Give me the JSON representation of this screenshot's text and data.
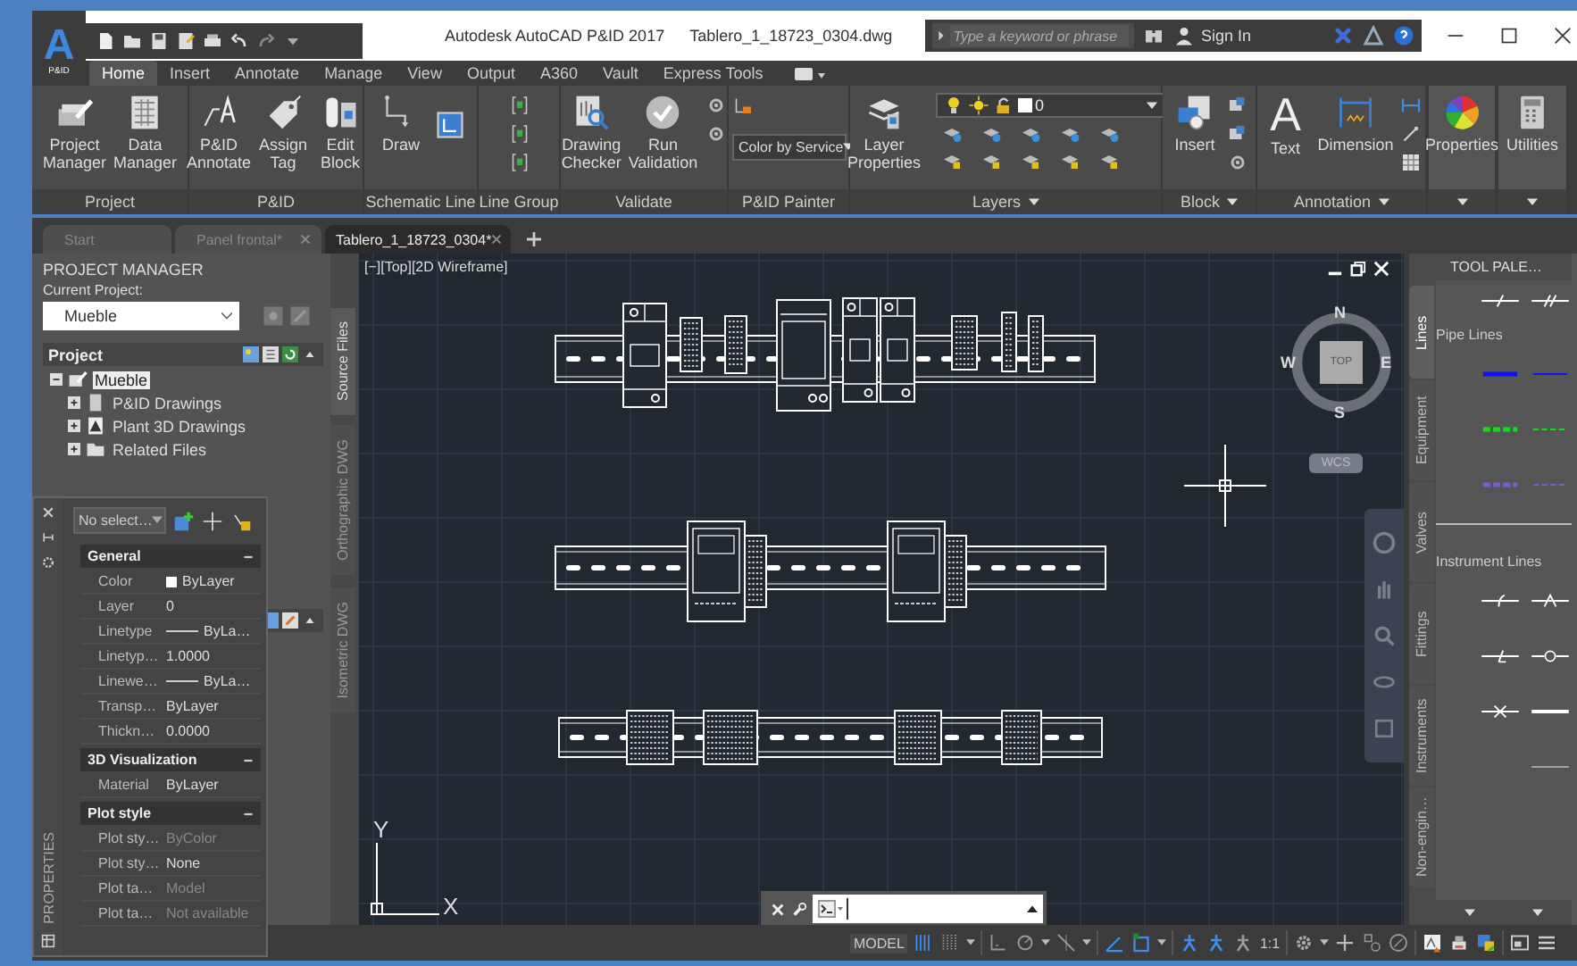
{
  "app": {
    "logo": "A",
    "logo_sub": "P&ID"
  },
  "title": {
    "app_name": "Autodesk AutoCAD P&ID 2017",
    "file": "Tablero_1_18723_0304.dwg"
  },
  "search": {
    "placeholder": "Type a keyword or phrase"
  },
  "sign_in": "Sign In",
  "ribbon_tabs": [
    {
      "label": "Home",
      "selected": true
    },
    {
      "label": "Insert",
      "selected": false
    },
    {
      "label": "Annotate",
      "selected": false
    },
    {
      "label": "Manage",
      "selected": false
    },
    {
      "label": "View",
      "selected": false
    },
    {
      "label": "Output",
      "selected": false
    },
    {
      "label": "A360",
      "selected": false
    },
    {
      "label": "Vault",
      "selected": false
    },
    {
      "label": "Express Tools",
      "selected": false
    }
  ],
  "ribbon_panels": [
    {
      "title": "Project",
      "buttons": [
        {
          "label": "Project Manager"
        },
        {
          "label": "Data Manager"
        }
      ]
    },
    {
      "title": "P&ID",
      "buttons": [
        {
          "label": "P&ID Annotate"
        },
        {
          "label": "Assign Tag"
        },
        {
          "label": "Edit Block"
        }
      ]
    },
    {
      "title": "Schematic Line",
      "buttons": [
        {
          "label": "Draw"
        }
      ]
    },
    {
      "title": "Line Group"
    },
    {
      "title": "Validate",
      "buttons": [
        {
          "label": "Drawing Checker"
        },
        {
          "label": "Run Validation"
        }
      ]
    },
    {
      "title": "P&ID Painter",
      "dropdown": "Color by Service"
    },
    {
      "title": "Layers",
      "menu": true,
      "buttons": [
        {
          "label": "Layer Properties"
        }
      ],
      "layer_dropdown": "0"
    },
    {
      "title": "Block",
      "menu": true,
      "buttons": [
        {
          "label": "Insert"
        }
      ]
    },
    {
      "title": "Annotation",
      "menu": true,
      "buttons": [
        {
          "label": "Text",
          "glyph": "A"
        },
        {
          "label": "Dimension"
        }
      ]
    },
    {
      "menu": true,
      "buttons": [
        {
          "label": "Properties"
        }
      ]
    },
    {
      "menu": true,
      "buttons": [
        {
          "label": "Utilities"
        }
      ]
    }
  ],
  "doc_tabs": [
    {
      "label": "Start",
      "selected": false,
      "closable": false
    },
    {
      "label": "Panel frontal*",
      "selected": false,
      "closable": true
    },
    {
      "label": "Tablero_1_18723_0304*",
      "selected": true,
      "closable": true
    }
  ],
  "project_manager": {
    "title": "PROJECT MANAGER",
    "current_label": "Current Project:",
    "current": "Mueble",
    "section": "Project",
    "tree": [
      {
        "label": "Mueble",
        "expanded": true,
        "selected": true,
        "children": [
          {
            "label": "P&ID Drawings",
            "expanded": false,
            "selected": false
          },
          {
            "label": "Plant 3D Drawings",
            "expanded": false,
            "selected": false
          },
          {
            "label": "Related Files",
            "expanded": false,
            "selected": false
          }
        ]
      }
    ],
    "side_tabs": [
      {
        "label": "Source Files",
        "selected": true
      },
      {
        "label": "Orthographic DWG",
        "selected": false
      },
      {
        "label": "Isometric DWG",
        "selected": false
      }
    ]
  },
  "properties": {
    "side_title": "PROPERTIES",
    "selection": "No select…",
    "sections": [
      {
        "title": "General",
        "rows": [
          {
            "name": "Color",
            "value": "ByLayer",
            "kind": "swatch",
            "disabled": false
          },
          {
            "name": "Layer",
            "value": "0",
            "kind": "text",
            "disabled": false
          },
          {
            "name": "Linetype",
            "value": "ByLa…",
            "kind": "line",
            "disabled": false
          },
          {
            "name": "Linetyp…",
            "value": "1.0000",
            "kind": "text",
            "disabled": false
          },
          {
            "name": "Linewe…",
            "value": "ByLa…",
            "kind": "line",
            "disabled": false
          },
          {
            "name": "Transp…",
            "value": "ByLayer",
            "kind": "text",
            "disabled": false
          },
          {
            "name": "Thickn…",
            "value": "0.0000",
            "kind": "text",
            "disabled": false
          }
        ]
      },
      {
        "title": "3D Visualization",
        "rows": [
          {
            "name": "Material",
            "value": "ByLayer",
            "kind": "text",
            "disabled": false
          }
        ]
      },
      {
        "title": "Plot style",
        "rows": [
          {
            "name": "Plot sty…",
            "value": "ByColor",
            "kind": "text",
            "disabled": true
          },
          {
            "name": "Plot sty…",
            "value": "None",
            "kind": "text",
            "disabled": false
          },
          {
            "name": "Plot ta…",
            "value": "Model",
            "kind": "text",
            "disabled": true
          },
          {
            "name": "Plot ta…",
            "value": "Not available",
            "kind": "text",
            "disabled": true
          }
        ]
      }
    ]
  },
  "viewport": {
    "label": "[−][Top][2D Wireframe]",
    "viewcube": {
      "north": "N",
      "south": "S",
      "east": "E",
      "west": "W",
      "top": "TOP",
      "wcs": "WCS"
    },
    "ucs": {
      "x": "X",
      "y": "Y"
    }
  },
  "tool_palette": {
    "title": "TOOL PALE…",
    "tabs": [
      {
        "label": "Lines",
        "selected": true
      },
      {
        "label": "Equipment",
        "selected": false
      },
      {
        "label": "Valves",
        "selected": false
      },
      {
        "label": "Fittings",
        "selected": false
      },
      {
        "label": "Instruments",
        "selected": false
      },
      {
        "label": "Non-engin…",
        "selected": false
      }
    ],
    "pipe_heading": "Pipe Lines",
    "pipe_lines": [
      {
        "color": "#1010f0",
        "kind": "solid"
      },
      {
        "color": "#10e010",
        "kind": "dashed"
      },
      {
        "color": "#7a5cd0",
        "kind": "dashed"
      }
    ],
    "instrument_heading": "Instrument Lines"
  },
  "status_bar": {
    "model": "MODEL",
    "scale": "1:1",
    "toggles": [
      {
        "on": true
      },
      {
        "on": false
      },
      {
        "on": false
      },
      {
        "on": false
      },
      {
        "on": false
      },
      {
        "on": true
      },
      {
        "on": true
      },
      {
        "on": true
      },
      {
        "on": true
      },
      {
        "on": false
      }
    ]
  }
}
